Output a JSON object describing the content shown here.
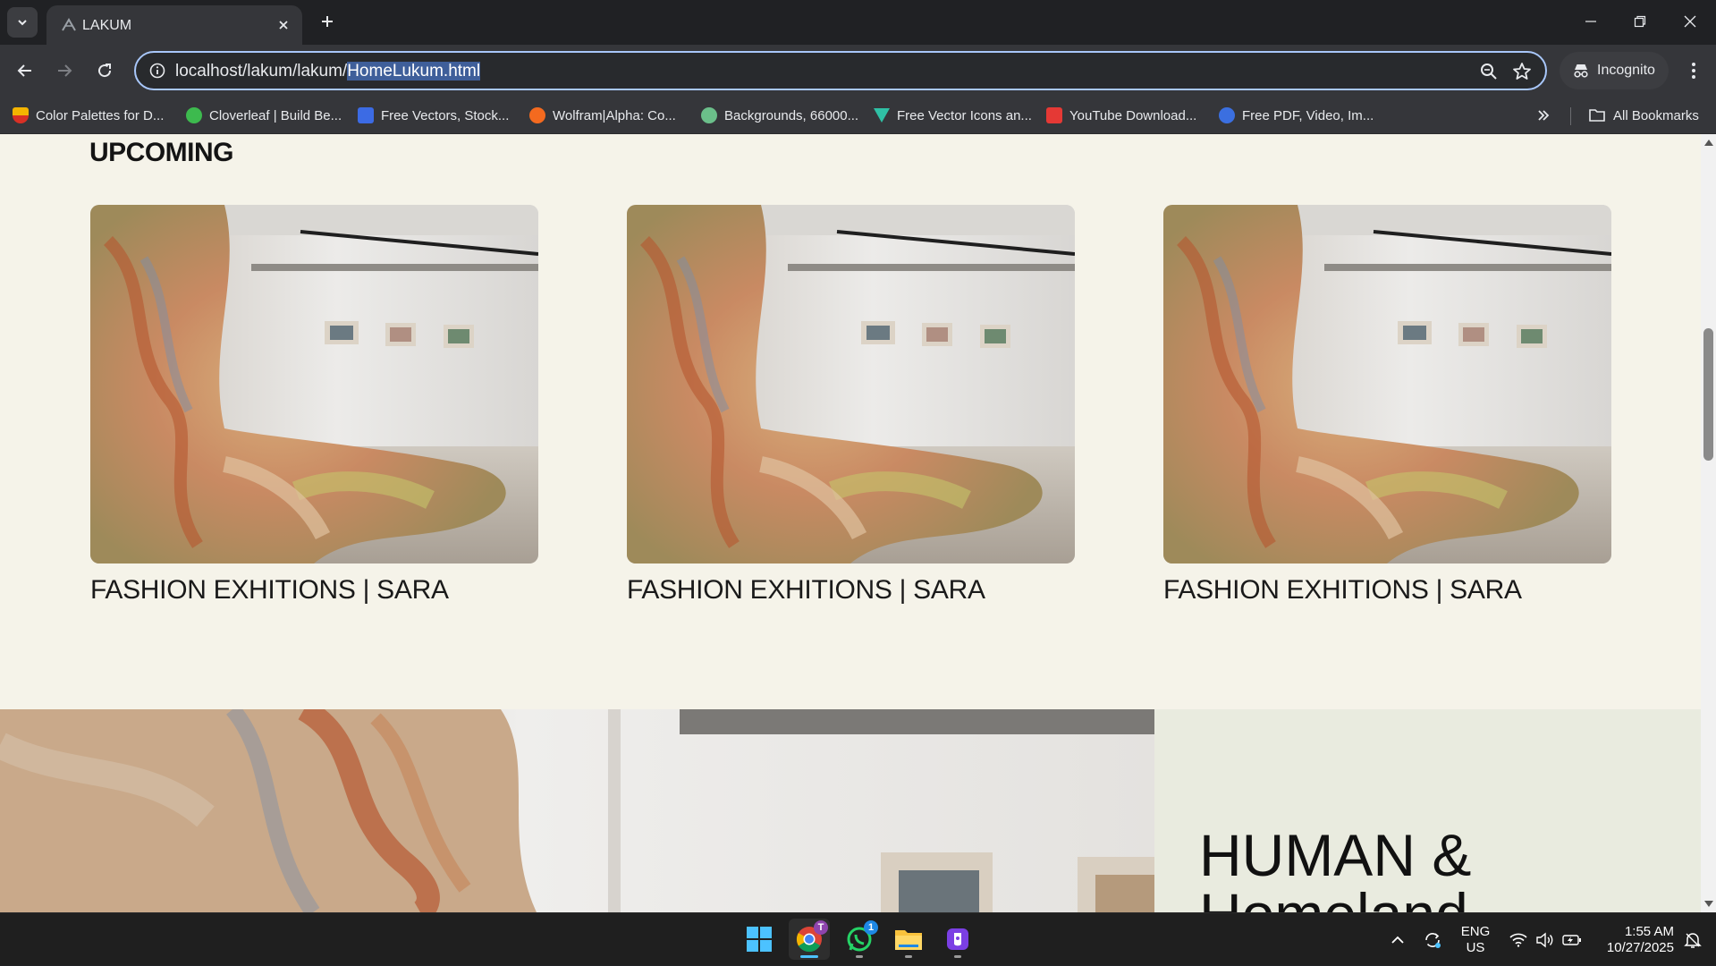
{
  "browser": {
    "tab": {
      "title": "LAKUM"
    },
    "url": {
      "prefix": "localhost/lakum/lakum/",
      "selected": "HomeLukum.html"
    },
    "incognito_label": "Incognito",
    "bookmarks": [
      {
        "label": "Color Palettes for D...",
        "icon_color": "#f4b400"
      },
      {
        "label": "Cloverleaf | Build Be...",
        "icon_color": "#3dba4e"
      },
      {
        "label": "Free Vectors, Stock...",
        "icon_color": "#3c6be4"
      },
      {
        "label": "Wolfram|Alpha: Co...",
        "icon_color": "#f46a1f"
      },
      {
        "label": "Backgrounds, 66000...",
        "icon_color": "#6bbf8a"
      },
      {
        "label": "Free Vector Icons an...",
        "icon_color": "#2fc0a5"
      },
      {
        "label": "YouTube Download...",
        "icon_color": "#e53935"
      },
      {
        "label": "Free PDF, Video, Im...",
        "icon_color": "#3b6fe0"
      }
    ],
    "all_bookmarks_label": "All Bookmarks"
  },
  "page": {
    "section_title": "UPCOMING",
    "cards": [
      {
        "caption": "FASHION EXHITIONS | SARA"
      },
      {
        "caption": "FASHION EXHITIONS | SARA"
      },
      {
        "caption": "FASHION EXHITIONS | SARA"
      }
    ],
    "feature_heading": "HUMAN &\nHomeland"
  },
  "taskbar": {
    "apps": [
      "windows-start",
      "chrome",
      "whatsapp",
      "file-explorer",
      "tor-browser"
    ],
    "chrome_badge": "T",
    "whatsapp_badge": "1",
    "lang_line1": "ENG",
    "lang_line2": "US",
    "time": "1:55 AM",
    "date": "10/27/2025"
  },
  "colors": {
    "page_bg": "#f5f3e9",
    "feature_panel_bg": "#e9ebdf",
    "omnibox_border": "#a8c7fa",
    "selection": "#3f5f9a"
  }
}
